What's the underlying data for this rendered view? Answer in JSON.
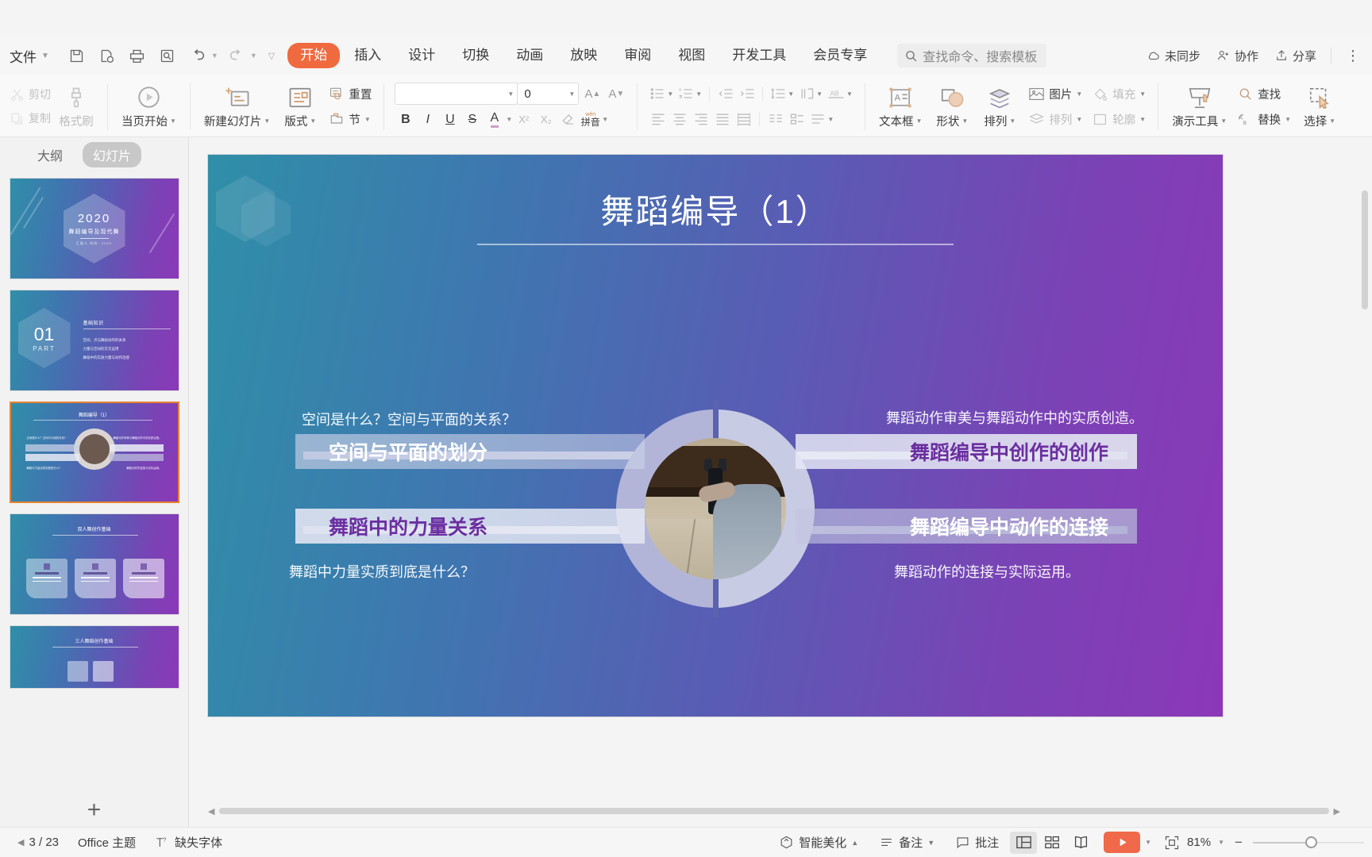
{
  "menubar": {
    "file_label": "文件",
    "quick_access": [
      "save-icon",
      "save-as-icon",
      "print-icon",
      "print-preview-icon",
      "undo-icon",
      "redo-icon",
      "customize-icon"
    ],
    "tabs": [
      {
        "label": "开始",
        "active": true
      },
      {
        "label": "插入",
        "active": false
      },
      {
        "label": "设计",
        "active": false
      },
      {
        "label": "切换",
        "active": false
      },
      {
        "label": "动画",
        "active": false
      },
      {
        "label": "放映",
        "active": false
      },
      {
        "label": "审阅",
        "active": false
      },
      {
        "label": "视图",
        "active": false
      },
      {
        "label": "开发工具",
        "active": false
      },
      {
        "label": "会员专享",
        "active": false
      }
    ],
    "search_placeholder": "查找命令、搜索模板",
    "sync_status": "未同步",
    "collaborate": "协作",
    "share": "分享",
    "more": "⋮"
  },
  "ribbon": {
    "cut": "剪切",
    "copy": "复制",
    "format_painter": "格式刷",
    "start_current": "当页开始",
    "new_slide": "新建幻灯片",
    "layout": "版式",
    "section": "节",
    "reset": "重置",
    "font_name": "",
    "font_name_placeholder": "",
    "font_size": "0",
    "bold": "B",
    "italic": "I",
    "underline": "U",
    "strikethrough": "S",
    "font_color": "A",
    "superscript": "X²",
    "subscript": "X₂",
    "clear_format": "clear-format-icon",
    "pinyin": "拼音",
    "textbox": "文本框",
    "shape": "形状",
    "arrange": "排列",
    "picture": "图片",
    "fill": "填充",
    "outline": "轮廓",
    "present_tools": "演示工具",
    "find": "查找",
    "replace": "替换",
    "select": "选择"
  },
  "left_panel": {
    "tabs": [
      {
        "label": "大纲",
        "active": false
      },
      {
        "label": "幻灯片",
        "active": true
      }
    ],
    "add_slide": "+",
    "thumbnails": [
      {
        "index": 1,
        "year": "2020",
        "subtitle": "舞蹈编导及现代舞",
        "tiny": "汇报人          时间：2020"
      },
      {
        "index": 2,
        "number": "01",
        "part": "PART",
        "heading": "基础知识",
        "bullets": [
          "空间、点与舞蹈动作的关系",
          "力量与空间的交叉运用",
          "舞蹈中的实质力量与动作连接"
        ]
      },
      {
        "index": 3,
        "title": "舞蹈编导（1）",
        "selected": true
      },
      {
        "index": 4,
        "title": "双人舞创作基础"
      },
      {
        "index": 5,
        "title": "三人舞蹈创作基础"
      }
    ]
  },
  "slide": {
    "title": "舞蹈编导（1）",
    "left_top_question": "空间是什么？空间与平面的关系？",
    "left_bar_1": "空间与平面的划分",
    "left_bar_2": "舞蹈中的力量关系",
    "left_bottom_question": "舞蹈中力量实质到底是什么？",
    "right_top_question": "舞蹈动作审美与舞蹈动作中的实质创造。",
    "right_bar_1": "舞蹈编导中创作的创作",
    "right_bar_2": "舞蹈编导中动作的连接",
    "right_bottom_question": "舞蹈动作的连接与实际运用。"
  },
  "status": {
    "page": "3 / 23",
    "theme": "Office 主题",
    "missing_font": "缺失字体",
    "smart_beautify": "智能美化",
    "notes": "备注",
    "comments": "批注",
    "views": [
      "normal-view-icon",
      "slide-sorter-icon",
      "reading-view-icon"
    ],
    "play": "play-icon",
    "fit_label": "81%",
    "zoom_out": "−",
    "zoom_in": "+"
  },
  "colors": {
    "accent": "#f06a3f",
    "slide_gradient_start": "#2f8fa8",
    "slide_gradient_end": "#8b38b8",
    "bar_purple_text": "#6b2fa0",
    "selected_thumb_border": "#e8832f"
  }
}
